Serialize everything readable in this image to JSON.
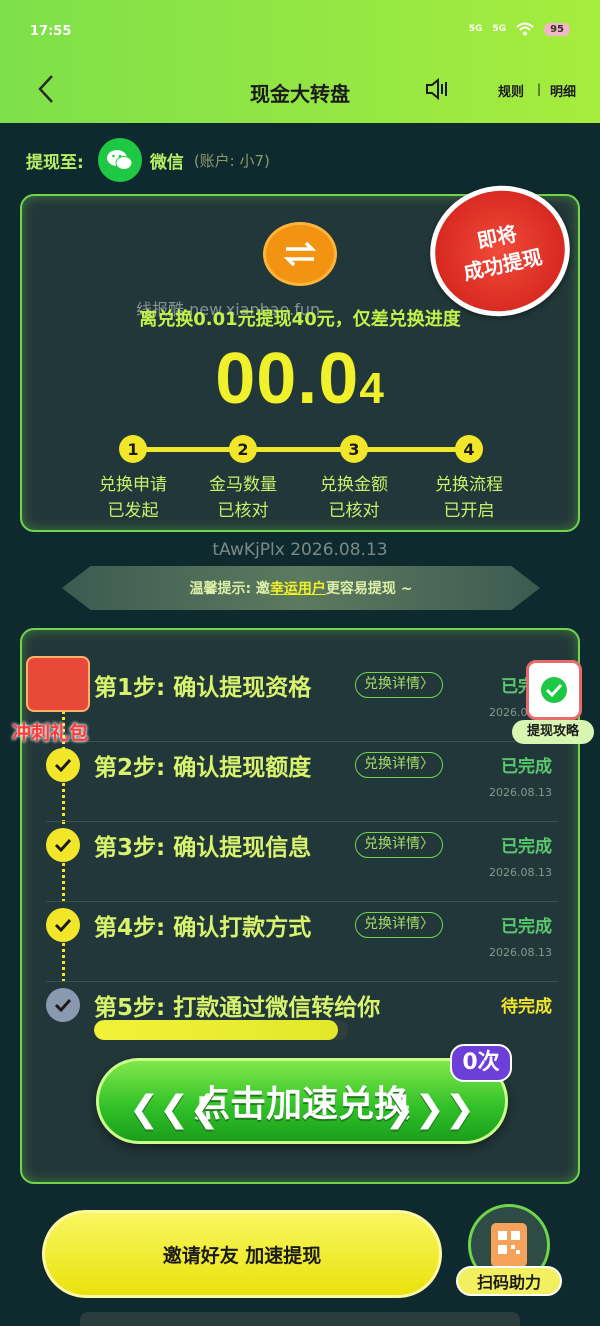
{
  "status_bar": {
    "time": "17:55",
    "signal1": "5G",
    "signal2": "5G",
    "battery": "95"
  },
  "header": {
    "title": "现金大转盘",
    "rules": "规则",
    "separator": "|",
    "details": "明细"
  },
  "withdraw": {
    "label": "提现至:",
    "method": "微信",
    "account": "(账户: 小7)"
  },
  "exchange_card": {
    "stamp_line1": "即将",
    "stamp_line2": "成功提现",
    "watermark": "线报酷 new.xianbao.fun",
    "progress_text": "离兑换0.01元提现40元，仅差兑换进度",
    "value_main": "00.0",
    "value_tail": "4",
    "stages": [
      {
        "num": "1",
        "line1": "兑换申请",
        "line2": "已发起"
      },
      {
        "num": "2",
        "line1": "金马数量",
        "line2": "已核对"
      },
      {
        "num": "3",
        "line1": "兑换金额",
        "line2": "已核对"
      },
      {
        "num": "4",
        "line1": "兑换流程",
        "line2": "已开启"
      }
    ]
  },
  "code_line": "tAwKjPlx 2026.08.13",
  "tip": {
    "prefix": "温馨提示: 邀",
    "highlight": "幸运用户",
    "suffix": "更容易提现 ~"
  },
  "steps": [
    {
      "title": "第1步: 确认提现资格",
      "detail": "兑换详情〉",
      "status": "已完成",
      "date": "2026.08.13"
    },
    {
      "title": "第2步: 确认提现额度",
      "detail": "兑换详情〉",
      "status": "已完成",
      "date": "2026.08.13"
    },
    {
      "title": "第3步: 确认提现信息",
      "detail": "兑换详情〉",
      "status": "已完成",
      "date": "2026.08.13"
    },
    {
      "title": "第4步: 确认打款方式",
      "detail": "兑换详情〉",
      "status": "已完成",
      "date": "2026.08.13"
    },
    {
      "title": "第5步: 打款通过微信转给你",
      "status": "待完成",
      "progress": 0.96
    }
  ],
  "gift_label": "冲刺礼包",
  "guide_label": "提现攻略",
  "speed_button": "点击加速兑换",
  "speed_count": "0次",
  "invite_button": "邀请好友  加速提现",
  "qr_label": "扫码助力",
  "colors": {
    "accent": "#7ee04a",
    "yellow": "#f2e62a",
    "done": "#59c86e"
  }
}
